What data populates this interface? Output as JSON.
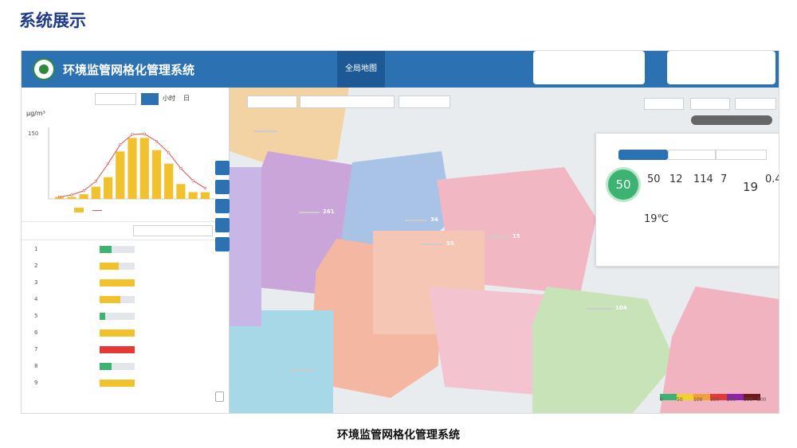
{
  "slide": {
    "title": "系统展示",
    "caption": "环境监管网格化管理系统"
  },
  "app": {
    "title": "环境监管网格化管理系统",
    "nav": [
      "全局地图"
    ]
  },
  "left_panel": {
    "unit": "μg/m³",
    "time_filters": [
      "小时",
      "日"
    ],
    "legend_series": "",
    "chart_data": {
      "type": "bar",
      "series": [
        {
          "name": "",
          "type": "bar",
          "values": [
            3,
            3,
            7,
            18,
            32,
            70,
            90,
            90,
            72,
            52,
            22,
            10,
            10
          ]
        },
        {
          "name": "",
          "type": "line",
          "values": [
            3,
            6,
            12,
            26,
            52,
            80,
            95,
            96,
            85,
            68,
            45,
            27,
            16
          ]
        }
      ],
      "ylim": [
        0,
        160
      ],
      "y_ticks": [
        "150"
      ]
    },
    "rows": [
      {
        "rank": "1",
        "fill": 0.35,
        "color": "#3cb371"
      },
      {
        "rank": "2",
        "fill": 0.55,
        "color": "#f2c12e"
      },
      {
        "rank": "3",
        "fill": 1.0,
        "color": "#f2c12e"
      },
      {
        "rank": "4",
        "fill": 0.6,
        "color": "#f2c12e"
      },
      {
        "rank": "5",
        "fill": 0.15,
        "color": "#3cb371"
      },
      {
        "rank": "6",
        "fill": 1.0,
        "color": "#f2c12e"
      },
      {
        "rank": "7",
        "fill": 1.0,
        "color": "#e53935"
      },
      {
        "rank": "8",
        "fill": 0.33,
        "color": "#3cb371"
      },
      {
        "rank": "9",
        "fill": 1.0,
        "color": "#f2c12e"
      }
    ]
  },
  "map": {
    "markers": [
      {
        "value": "261",
        "color": "#e53935"
      },
      {
        "value": "34",
        "color": "#3cb371"
      },
      {
        "value": "55",
        "color": "#3cb371"
      },
      {
        "value": "15",
        "color": "#3cb371"
      },
      {
        "value": "104",
        "color": "#f2a03a"
      }
    ],
    "info_card": {
      "aqi": "50",
      "pollutants": [
        {
          "value": "50"
        },
        {
          "value": "12"
        },
        {
          "value": "114"
        },
        {
          "value": "7"
        },
        {
          "value": "19"
        },
        {
          "value": "0.4"
        }
      ],
      "temperature": "19℃"
    },
    "scale": {
      "colors": [
        "#3cb371",
        "#f2d12e",
        "#f2a03a",
        "#e53935",
        "#8e24aa",
        "#6d1b1b"
      ],
      "ticks": [
        "0",
        "50",
        "100",
        "150",
        "200",
        "300",
        "500"
      ]
    }
  }
}
